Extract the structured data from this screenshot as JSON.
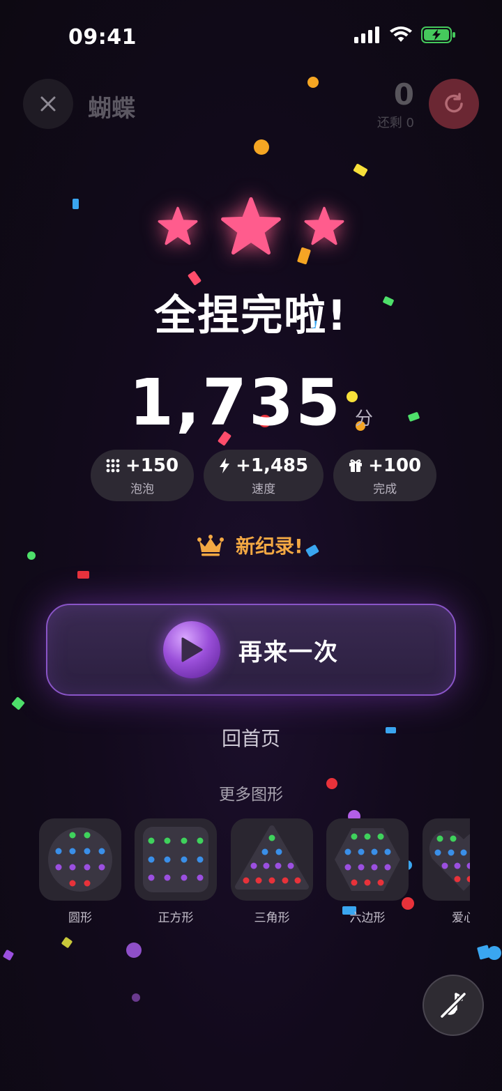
{
  "status_bar": {
    "time": "09:41"
  },
  "top_bar": {
    "title": "蝴蝶",
    "counter": "0",
    "remaining": "还剩 0"
  },
  "result": {
    "title": "全捏完啦!",
    "score": "1,735",
    "score_unit": "分",
    "stars": 3,
    "breakdown": [
      {
        "icon": "grid-dots-icon",
        "value": "+150",
        "label": "泡泡"
      },
      {
        "icon": "lightning-icon",
        "value": "+1,485",
        "label": "速度"
      },
      {
        "icon": "gift-icon",
        "value": "+100",
        "label": "完成"
      }
    ],
    "new_record": "新纪录!"
  },
  "actions": {
    "replay": "再来一次",
    "home": "回首页"
  },
  "more": {
    "title": "更多图形",
    "shapes": [
      {
        "label": "圆形",
        "icon": "circle-pattern-icon"
      },
      {
        "label": "正方形",
        "icon": "square-pattern-icon"
      },
      {
        "label": "三角形",
        "icon": "triangle-pattern-icon"
      },
      {
        "label": "六边形",
        "icon": "hexagon-pattern-icon"
      },
      {
        "label": "爱心",
        "icon": "heart-pattern-icon"
      }
    ]
  },
  "colors": {
    "star": "#ff5c8d",
    "record": "#f3a843",
    "restart": "#6b2733",
    "bead_green": "#3fd25c",
    "bead_blue": "#3a8fe8",
    "bead_purple": "#9b4fe0",
    "bead_red": "#e8323a"
  }
}
